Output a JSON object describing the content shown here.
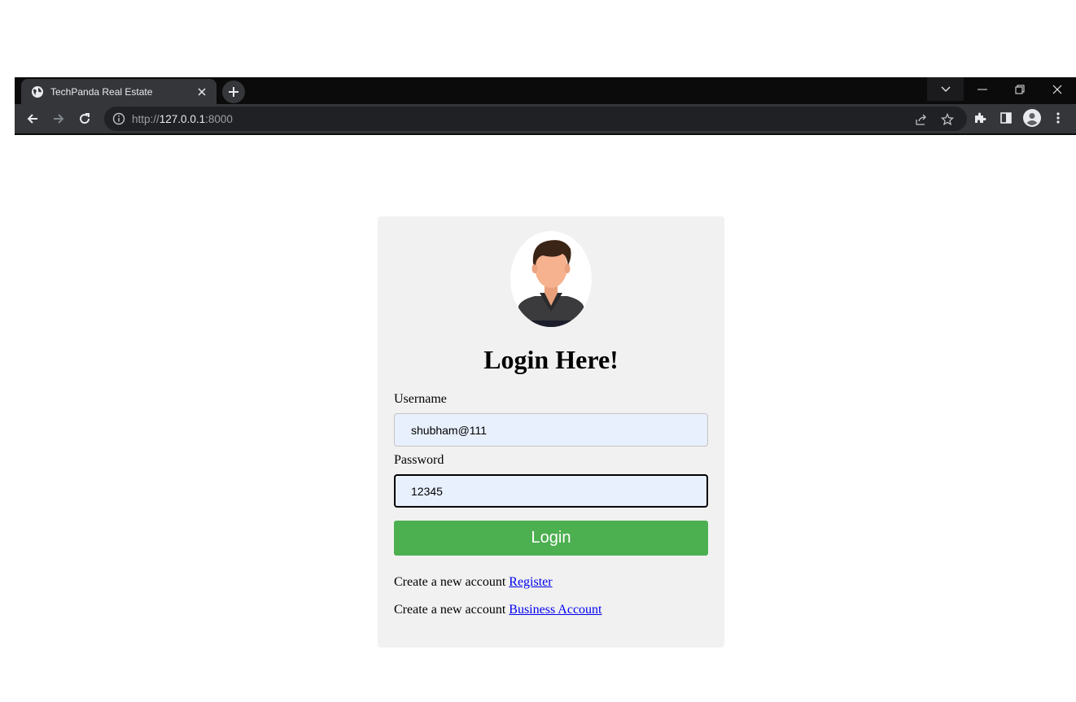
{
  "browser": {
    "tab_title": "TechPanda Real Estate",
    "url": {
      "scheme": "http://",
      "host": "127.0.0.1",
      "port": ":8000"
    }
  },
  "login": {
    "heading": "Login Here!",
    "username_label": "Username",
    "username_value": "shubham@111",
    "password_label": "Password",
    "password_value": "12345",
    "button_label": "Login",
    "register_prefix": "Create a new account ",
    "register_link": "Register",
    "business_prefix": "Create a new account ",
    "business_link": "Business Account"
  },
  "colors": {
    "button": "#4caf50",
    "card": "#f1f1f1",
    "autofill": "#e8f0fe",
    "link": "#0000ee"
  }
}
